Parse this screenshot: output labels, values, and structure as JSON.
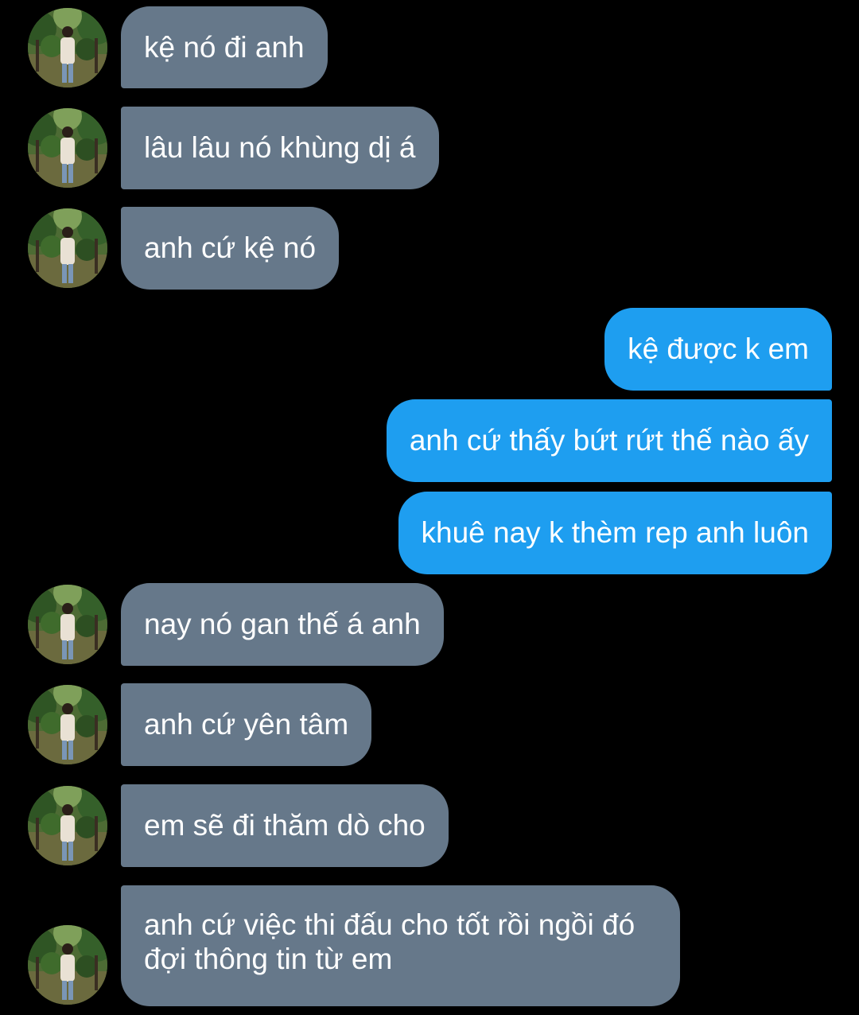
{
  "colors": {
    "background": "#000000",
    "incoming_bubble": "#66788a",
    "outgoing_bubble": "#1e9ef0",
    "text": "#ffffff"
  },
  "contact": {
    "avatar_icon": "profile-photo-avatar"
  },
  "messages": [
    {
      "direction": "incoming",
      "text": "kệ nó đi anh"
    },
    {
      "direction": "incoming",
      "text": "lâu lâu nó khùng dị á"
    },
    {
      "direction": "incoming",
      "text": "anh cứ kệ nó"
    },
    {
      "direction": "outgoing",
      "text": "kệ được k em"
    },
    {
      "direction": "outgoing",
      "text": "anh cứ thấy bứt rứt thế nào ấy"
    },
    {
      "direction": "outgoing",
      "text": "khuê nay k thèm rep anh luôn"
    },
    {
      "direction": "incoming",
      "text": "nay nó gan thế á anh"
    },
    {
      "direction": "incoming",
      "text": "anh cứ yên tâm"
    },
    {
      "direction": "incoming",
      "text": "em sẽ đi thăm dò cho"
    },
    {
      "direction": "incoming",
      "text": "anh cứ việc thi đấu cho tốt rồi ngồi đó đợi thông tin từ em"
    }
  ]
}
